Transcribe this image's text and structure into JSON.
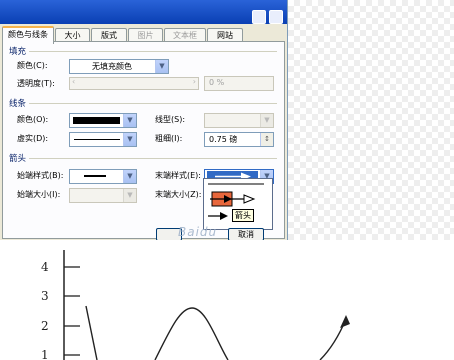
{
  "dialog": {
    "tabs": [
      {
        "label": "颜色与线条",
        "state": "active"
      },
      {
        "label": "大小",
        "state": "normal"
      },
      {
        "label": "版式",
        "state": "normal"
      },
      {
        "label": "图片",
        "state": "disabled"
      },
      {
        "label": "文本框",
        "state": "disabled"
      },
      {
        "label": "网站",
        "state": "normal"
      }
    ],
    "fill": {
      "section": "填充",
      "color_label": "颜色(C):",
      "color_value": "无填充颜色",
      "transparency_label": "透明度(T):",
      "transparency_value": "0 %"
    },
    "line": {
      "section": "线条",
      "color_label": "颜色(O):",
      "dash_label": "虚实(D):",
      "style_label": "线型(S):",
      "weight_label": "粗细(I):",
      "weight_value": "0.75 磅"
    },
    "arrows": {
      "section": "箭头",
      "begin_style_label": "始端样式(B):",
      "begin_size_label": "始端大小(I):",
      "end_style_label": "末端样式(E):",
      "end_size_label": "末端大小(Z):",
      "popup_tooltip": "箭头"
    },
    "footer_button": "取消"
  },
  "watermark": "Baidu",
  "chart_data": {
    "type": "line",
    "yticks": [
      "4",
      "3",
      "2",
      "1"
    ]
  },
  "colors": {
    "accent_tab": "#f5b34c",
    "selected_arrow": "#e8673c",
    "combo_button": "#a8c1f2"
  }
}
